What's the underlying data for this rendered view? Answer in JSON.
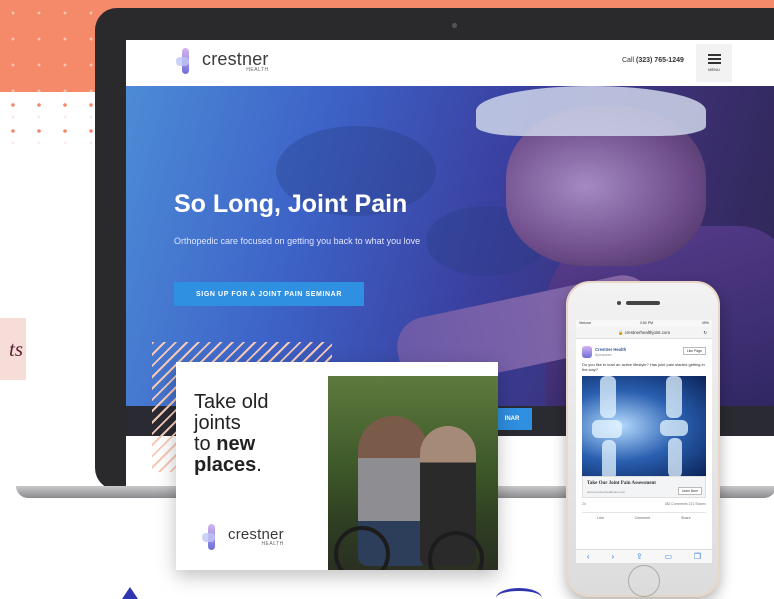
{
  "colors": {
    "coral": "#f48a6a",
    "brand_blue": "#2f8fe0",
    "ink": "#222222"
  },
  "background": {
    "word_fragment": "ts"
  },
  "site": {
    "logo": {
      "name": "crestner",
      "sub": "HEALTH"
    },
    "call_prefix": "Call",
    "phone": "(323) 765-1249",
    "menu_label": "MENU",
    "hero": {
      "title": "So Long, Joint Pain",
      "subtitle": "Orthopedic care focused on getting you back to what you love",
      "cta": "SIGN UP FOR A JOINT PAIN SEMINAR"
    },
    "band_button": "INAR"
  },
  "ad": {
    "line1": "Take old",
    "line2": "joints",
    "line3_prefix": "to",
    "line3_bold": "new",
    "line4_bold": "places",
    "line4_suffix": ".",
    "logo_name": "crestner",
    "logo_sub": "HEALTH"
  },
  "phone": {
    "status_left": "Verizon",
    "status_time": "3:50 PM",
    "status_right": "49%",
    "url": "crestnerhealthjoint.com",
    "post": {
      "page_name": "Crestner Health",
      "sponsored": "Sponsored",
      "like_page": "Like Page",
      "copy": "Do you like to lead an active lifestyle? Has joint pain started getting in the way?",
      "cta_title": "Take Our Joint Pain Assessment",
      "cta_url": "www.crestnerhealthjoint.com",
      "learn_more": "Learn More",
      "reactions_count": "24",
      "comments": "382 Comments",
      "shares": "221 Shares",
      "actions": [
        "Like",
        "Comment",
        "Share"
      ]
    }
  }
}
